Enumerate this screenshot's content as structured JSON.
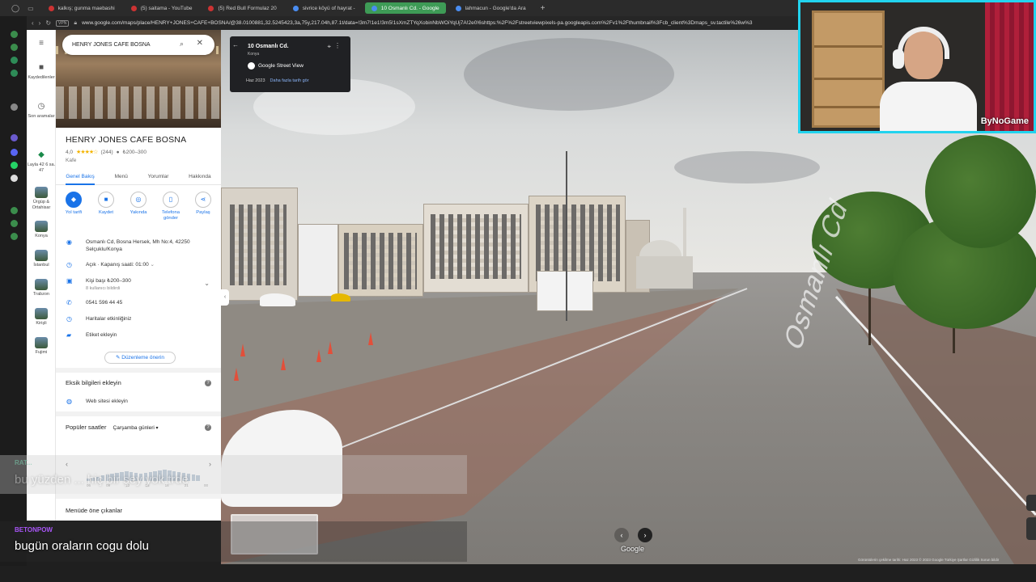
{
  "browser": {
    "tabs": [
      {
        "label": "kalkış; gunma maebashi",
        "icon": "red-circle-icon"
      },
      {
        "label": "(5) saitama - YouTube",
        "icon": "youtube-icon"
      },
      {
        "label": "(5) Red Bull Formulaz 20",
        "icon": "youtube-icon"
      },
      {
        "label": "sivrice köyü of hayrat -",
        "icon": "globe-icon"
      },
      {
        "label": "10 Osmanlı Cd. - Google",
        "icon": "maps-icon",
        "active": true
      },
      {
        "label": "lahmacun - Google'da Ara",
        "icon": "google-icon"
      }
    ],
    "new_tab": "+",
    "vpn": "VPN",
    "url": "www.google.com/maps/place/HENRY+JONES+CAFE+BOSNA/@38.0100881,32.5245423,3a,75y,217.04h,87.1t/data=!3m7!1e1!3m5!1sXmZTYqXobinNbWOiYqUj7A!2e0!6shttps:%2F%2Fstreetviewpixels-pa.googleapis.com%2Fv1%2Fthumbnail%3Fcb_client%3Dmaps_sv.tactile%26w%3"
  },
  "maps_nav": {
    "menu_icon": "≡",
    "items": [
      {
        "label": "Kaydedilenler",
        "icon": "bookmark-icon"
      },
      {
        "label": "Son aramalar",
        "icon": "history-icon"
      },
      {
        "label": "Layla 42 6 sa. 47",
        "icon": "pin-icon"
      },
      {
        "label": "Ürgüp & Ortahisar",
        "icon": "place-thumb"
      },
      {
        "label": "Konya",
        "icon": "place-thumb"
      },
      {
        "label": "İstanbul",
        "icon": "place-thumb"
      },
      {
        "label": "Trabzon",
        "icon": "place-thumb"
      },
      {
        "label": "Kirişli",
        "icon": "place-thumb"
      },
      {
        "label": "Fujimi",
        "icon": "place-thumb"
      }
    ]
  },
  "search": {
    "value": "HENRY JONES CAFE BOSNA"
  },
  "place": {
    "name": "HENRY JONES CAFE BOSNA",
    "rating": "4,0",
    "stars": "★★★★☆",
    "reviews": "(244)",
    "price": "₺200–300",
    "type": "Kafe",
    "tabs": [
      "Genel Bakış",
      "Menü",
      "Yorumlar",
      "Hakkında"
    ],
    "actions": [
      {
        "label": "Yol tarifi",
        "icon": "directions-icon"
      },
      {
        "label": "Kaydet",
        "icon": "bookmark-icon"
      },
      {
        "label": "Yakında",
        "icon": "nearby-icon"
      },
      {
        "label": "Telefona gönder",
        "icon": "phone-send-icon"
      },
      {
        "label": "Paylaş",
        "icon": "share-icon"
      }
    ],
    "address": "Osmanlı Cd, Bosna Hersek, Mh No:4, 42250 Selçuklu/Konya",
    "hours": "Açık · Kapanış saati: 01:00",
    "price_per_person": "Kişi başı ₺200–300",
    "price_sub": "8 kullanıcı bildirdi",
    "phone": "0541 596 44 45",
    "activity": "Haritalar etkinliğiniz",
    "label_add": "Etiket ekleyin",
    "suggest_edit": "Düzenleme önerin",
    "missing_info": "Eksik bilgileri ekleyin",
    "website": "Web sitesi ekleyin",
    "popular": "Popüler saatler",
    "popular_day": "Çarşamba günleri",
    "hour_labels": [
      "06",
      "09",
      "12",
      "15",
      "18",
      "21",
      "00"
    ],
    "highlights": "Menüde öne çıkanlar"
  },
  "streetview": {
    "street": "10 Osmanlı Cd.",
    "city": "Konya",
    "source": "Google Street View",
    "date": "Haz 2023",
    "more_dates": "Daha fazla tarih gör",
    "road_marking": "Osmanlı Cd",
    "watermark": "Google",
    "footer": "Görüntülerin çekilme tarihi: Haz 2023  © 2023 Google  Türkiye  Şartlar  Gizlilik  Sorun bildir"
  },
  "overlay": {
    "chat1_name": "RAT...",
    "chat1": "bu yüzden ... hiç bir şey yok trde",
    "chat2_name": "BETONPOW",
    "chat2": "bugün oraların cogu dolu",
    "webcam_brand": "ByNoGame"
  },
  "colors": {
    "accent": "#1a73e8",
    "tab_active": "#3e9b56",
    "webcam_border": "#22d3ee",
    "chat_name": "#a855f7"
  }
}
